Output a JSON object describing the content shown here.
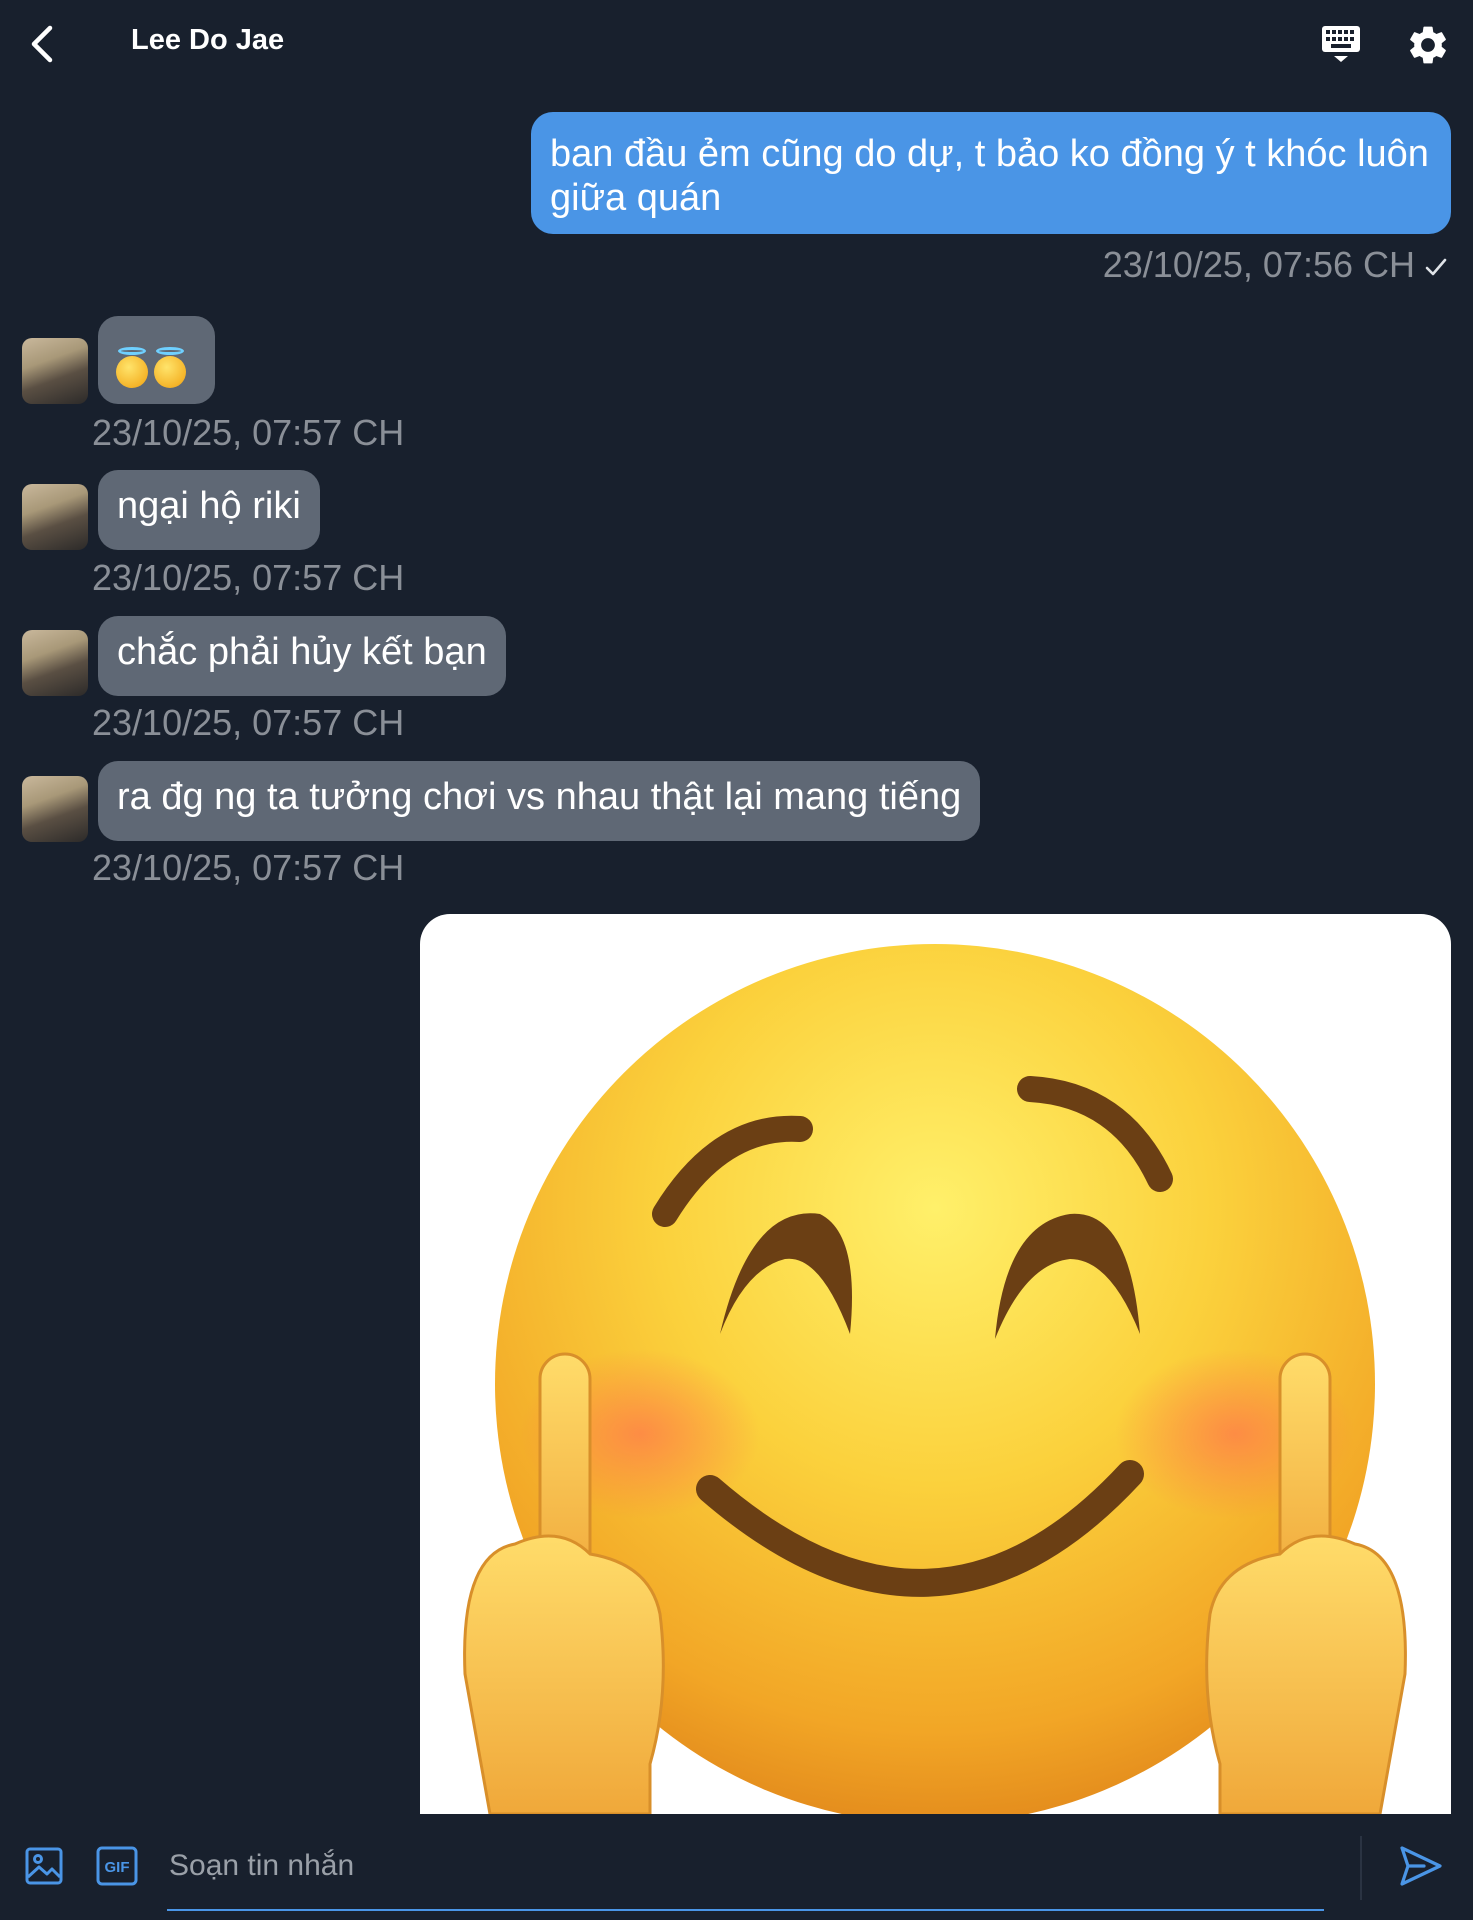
{
  "header": {
    "contact_name": "Lee Do Jae"
  },
  "messages": [
    {
      "direction": "outgoing",
      "text": "ban đầu ẻm cũng do dự, t bảo ko đồng ý t khóc luôn giữa quán",
      "time": "23/10/25, 07:56 CH"
    },
    {
      "direction": "incoming",
      "text": "😇😇",
      "time": "23/10/25, 07:57 CH"
    },
    {
      "direction": "incoming",
      "text": "ngại hộ riki",
      "time": "23/10/25, 07:57 CH"
    },
    {
      "direction": "incoming",
      "text": "chắc phải hủy kết bạn",
      "time": "23/10/25, 07:57 CH"
    },
    {
      "direction": "incoming",
      "text": "ra đg ng ta tưởng chơi vs nhau thật lại mang tiếng",
      "time": "23/10/25, 07:57 CH"
    },
    {
      "direction": "outgoing",
      "type": "image",
      "image_name": "smiling-face-middle-fingers-emoji"
    }
  ],
  "composer": {
    "placeholder": "Soạn tin nhắn",
    "gif_label": "GIF"
  },
  "icons": [
    "back-arrow-icon",
    "keyboard-icon",
    "gear-icon",
    "image-icon",
    "gif-icon",
    "send-icon",
    "check-icon"
  ],
  "colors": {
    "background": "#18202d",
    "outgoing_bubble": "#4a95e6",
    "incoming_bubble": "#5f6875",
    "timestamp": "#8a8f97",
    "accent": "#4a95e6"
  }
}
